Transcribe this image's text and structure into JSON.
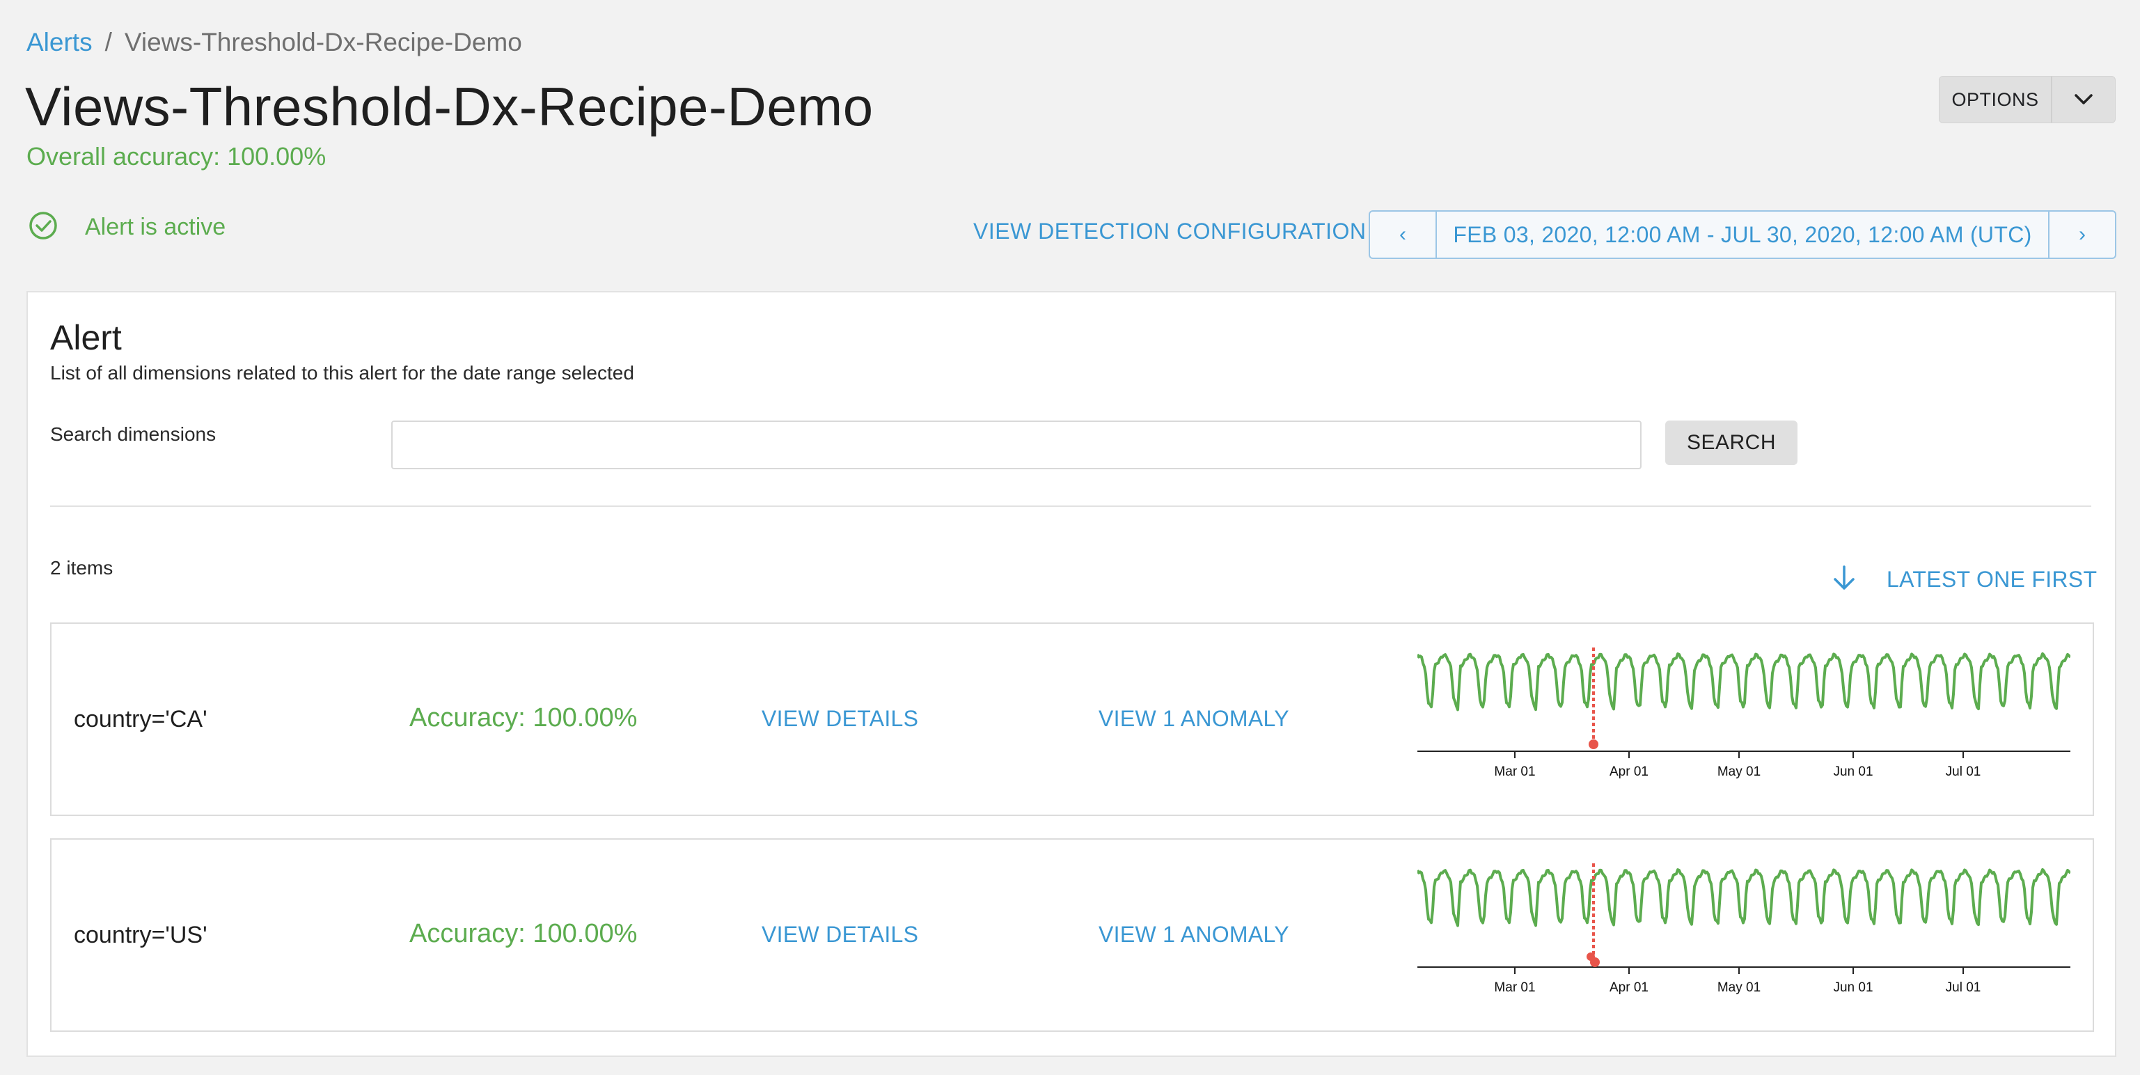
{
  "breadcrumb": {
    "root": "Alerts",
    "separator": "/",
    "current": "Views-Threshold-Dx-Recipe-Demo"
  },
  "page": {
    "title": "Views-Threshold-Dx-Recipe-Demo",
    "overall_accuracy": "Overall accuracy: 100.00%"
  },
  "options": {
    "label": "OPTIONS",
    "icon": "chevron-down-icon"
  },
  "status": {
    "icon": "check-circle-icon",
    "text": "Alert is active"
  },
  "actions": {
    "view_config": "VIEW DETECTION CONFIGURATION"
  },
  "date_range": {
    "prev": "‹",
    "label": "FEB 03, 2020, 12:00 AM - JUL 30, 2020, 12:00 AM (UTC)",
    "next": "›"
  },
  "alert_card": {
    "title": "Alert",
    "description": "List of all dimensions related to this alert for the date range selected",
    "search_label": "Search dimensions",
    "search_value": "",
    "search_button": "SEARCH",
    "items_count": "2 items",
    "sort": {
      "icon": "arrow-down-icon",
      "label": "LATEST ONE FIRST"
    },
    "rows": [
      {
        "dimension": "country='CA'",
        "accuracy": "Accuracy: 100.00%",
        "view_details": "VIEW DETAILS",
        "view_anomaly": "VIEW 1 ANOMALY"
      },
      {
        "dimension": "country='US'",
        "accuracy": "Accuracy: 100.00%",
        "view_details": "VIEW DETAILS",
        "view_anomaly": "VIEW 1 ANOMALY"
      }
    ]
  },
  "sparkline": {
    "ticks": [
      "Mar 01",
      "Apr 01",
      "May 01",
      "Jun 01",
      "Jul 01"
    ]
  },
  "colors": {
    "accent": "#3a97d3",
    "success": "#5cac4f",
    "anomaly": "#e8544a"
  }
}
